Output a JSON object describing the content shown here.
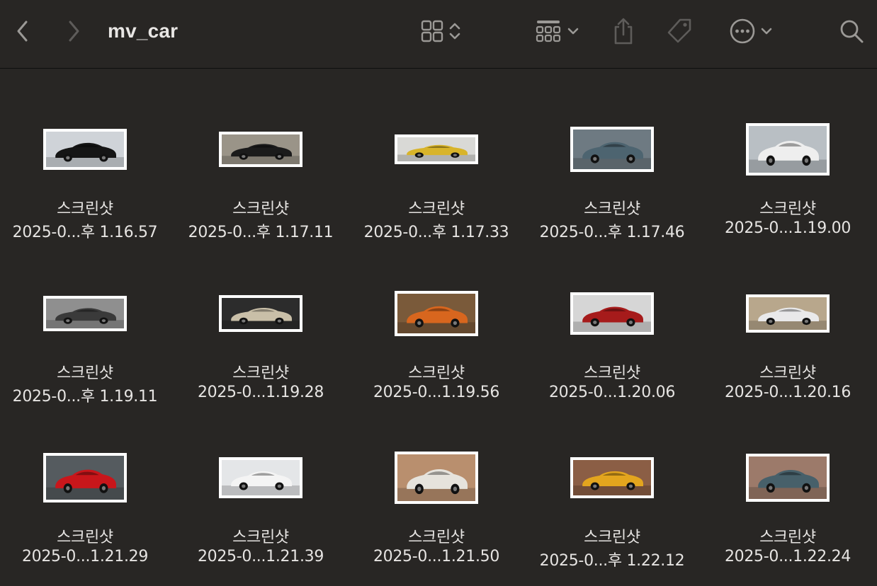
{
  "window": {
    "title": "mv_car"
  },
  "toolbar": {
    "back_icon": "chevron-left-icon",
    "forward_icon": "chevron-right-icon",
    "view_icon": "icon-grid-view-icon",
    "group_icon": "group-by-icon",
    "share_icon": "share-icon",
    "tag_icon": "tag-icon",
    "more_icon": "ellipsis-circle-icon",
    "search_icon": "search-icon"
  },
  "files": [
    {
      "name_line1": "스크린샷",
      "name_line2": "2025-0...후 1.16.57",
      "thumb": {
        "bg": "#cfd3d8",
        "car": "#151515"
      }
    },
    {
      "name_line1": "스크린샷",
      "name_line2": "2025-0...후 1.17.11",
      "thumb": {
        "bg": "#9a9488",
        "car": "#1b1b1b"
      }
    },
    {
      "name_line1": "스크린샷",
      "name_line2": "2025-0...후 1.17.33",
      "thumb": {
        "bg": "#d9d9d6",
        "car": "#d8b42a"
      }
    },
    {
      "name_line1": "스크린샷",
      "name_line2": "2025-0...후 1.17.46",
      "thumb": {
        "bg": "#6e7a82",
        "car": "#4d6470"
      }
    },
    {
      "name_line1": "스크린샷",
      "name_line2": "2025-0...1.19.00",
      "thumb": {
        "bg": "#b9bfc4",
        "car": "#eeeeee"
      }
    },
    {
      "name_line1": "스크린샷",
      "name_line2": "2025-0...후 1.19.11",
      "thumb": {
        "bg": "#8f8f8f",
        "car": "#3a3a3a"
      }
    },
    {
      "name_line1": "스크린샷",
      "name_line2": "2025-0...1.19.28",
      "thumb": {
        "bg": "#2c2c2c",
        "car": "#c9bfa8"
      }
    },
    {
      "name_line1": "스크린샷",
      "name_line2": "2025-0...1.19.56",
      "thumb": {
        "bg": "#7a5a3a",
        "car": "#d8661e"
      }
    },
    {
      "name_line1": "스크린샷",
      "name_line2": "2025-0...1.20.06",
      "thumb": {
        "bg": "#d6d6d6",
        "car": "#a61b1b"
      }
    },
    {
      "name_line1": "스크린샷",
      "name_line2": "2025-0...1.20.16",
      "thumb": {
        "bg": "#b8a78c",
        "car": "#e9e9ea"
      }
    },
    {
      "name_line1": "스크린샷",
      "name_line2": "2025-0...1.21.29",
      "thumb": {
        "bg": "#555b5f",
        "car": "#c8161b"
      }
    },
    {
      "name_line1": "스크린샷",
      "name_line2": "2025-0...1.21.39",
      "thumb": {
        "bg": "#e4e6e8",
        "car": "#f4f4f4"
      }
    },
    {
      "name_line1": "스크린샷",
      "name_line2": "2025-0...1.21.50",
      "thumb": {
        "bg": "#b98f6e",
        "car": "#e6e3dc"
      }
    },
    {
      "name_line1": "스크린샷",
      "name_line2": "2025-0...후 1.22.12",
      "thumb": {
        "bg": "#8b5e45",
        "car": "#e3a51e"
      }
    },
    {
      "name_line1": "스크린샷",
      "name_line2": "2025-0...1.22.24",
      "thumb": {
        "bg": "#9c7a6a",
        "car": "#47606a"
      }
    }
  ],
  "colors": {
    "background": "#282624",
    "text": "#e6e4e2",
    "icon": "#9b9996",
    "icon_disabled": "#5e5c5a",
    "thumb_border": "#ffffff"
  }
}
